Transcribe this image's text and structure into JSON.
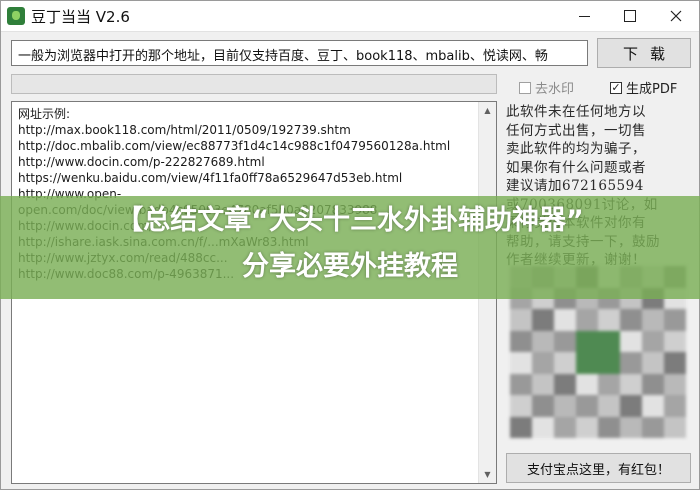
{
  "window": {
    "title": "豆丁当当  V2.6"
  },
  "url_input": {
    "value": "一般为浏览器中打开的那个地址，目前仅支持百度、豆丁、book118、mbalib、悦读网、畅"
  },
  "download_button": {
    "label": "下载"
  },
  "progress": {
    "fraction": 0.0
  },
  "options": {
    "remove_watermark": {
      "label": "去水印",
      "checked": false
    },
    "generate_pdf": {
      "label": "生成PDF",
      "checked": true
    }
  },
  "text_area": {
    "lines": [
      "网址示例:",
      "http://max.book118.com/html/2011/0509/192739.shtm",
      "http://doc.mbalib.com/view/ec88773f1d4c14c988c1f0479560128a.html",
      "http://www.docin.com/p-222827689.html",
      "https://wenku.baidu.com/view/4f11fa0ff78a6529647d53eb.html",
      "http://www.open-",
      "open.com/doc/view/badb4c95093e4780af5b0a8207833988",
      "http://www.docin.com/...",
      "http://ishare.iask.sina.com.cn/f/...mXaWr83.html",
      "http://www.jztyx.com/read/488cc...",
      "http://www.doc88.com/p-4963871..."
    ]
  },
  "notice": {
    "lines": [
      "此软件未在任何地方以",
      "任何方式出售，一切售",
      "卖此软件的均为骗子，",
      "如果你有什么问题或者",
      "建议请加672165594",
      "或700368091讨论，如",
      "果你觉得本软件对你有",
      "帮助，请支持一下，鼓励",
      "作者继续更新，谢谢！"
    ]
  },
  "pay_button": {
    "label": "支付宝点这里，有红包！"
  },
  "banner": {
    "line1": "【总结文章“大头十三水外卦辅助神器”",
    "line2": "分享必要外挂教程"
  },
  "colors": {
    "banner": "#7aaf55",
    "progress_fill": "#06b025"
  }
}
